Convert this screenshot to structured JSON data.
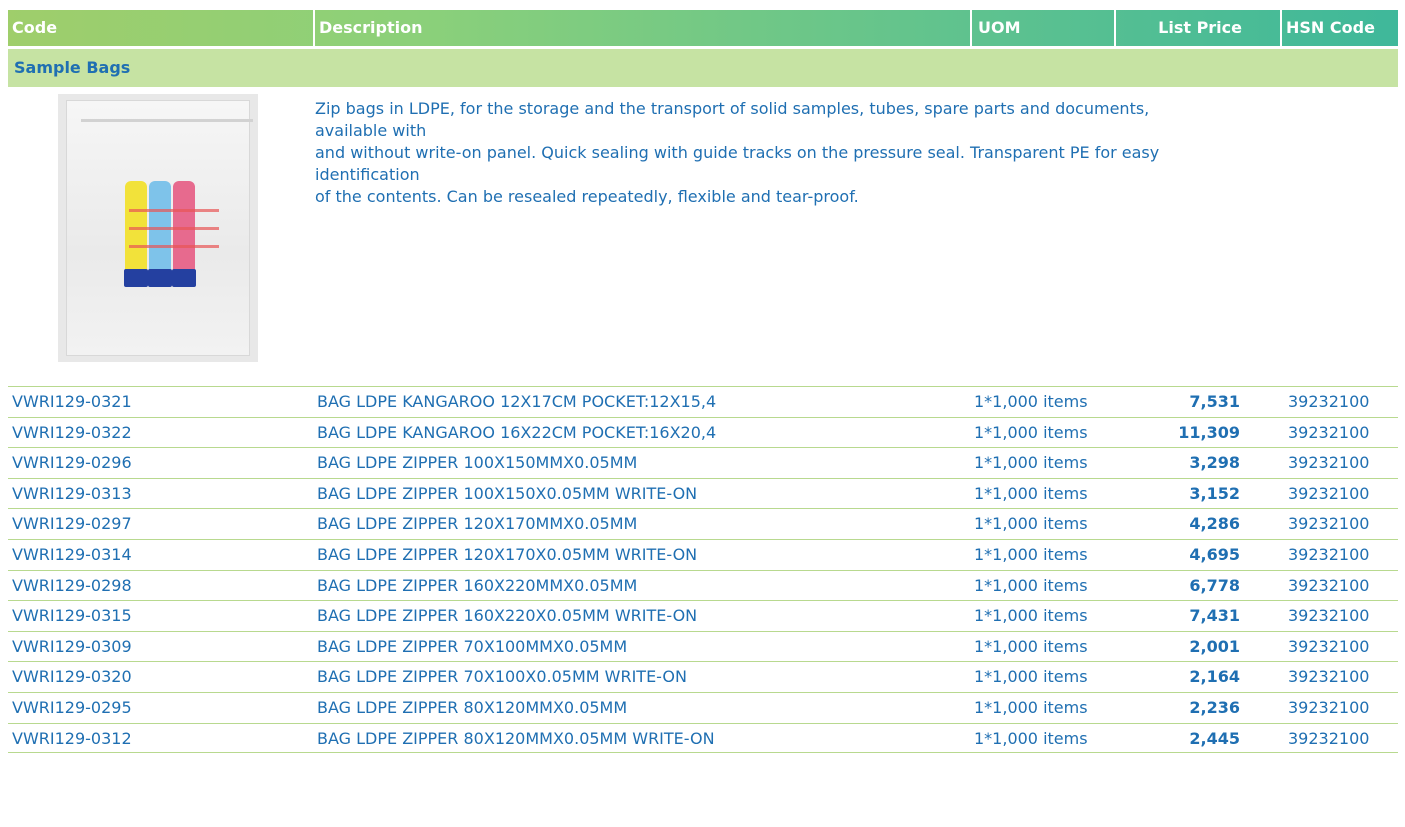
{
  "header": {
    "code": "Code",
    "description": "Description",
    "uom": "UOM",
    "list_price": "List Price",
    "hsn_code": "HSN Code"
  },
  "category": "Sample Bags",
  "product": {
    "description_lines": [
      "Zip bags in LDPE, for the storage and the transport of solid samples, tubes, spare parts and documents,",
      "available with",
      "and without write-on panel. Quick sealing with guide tracks on the pressure seal. Transparent PE for easy",
      "identification",
      "of the contents. Can be resealed repeatedly, flexible and tear-proof."
    ],
    "image_icon": "sample-bag-photo"
  },
  "rows": [
    {
      "code": "VWRI129-0321",
      "description": "BAG LDPE KANGAROO 12X17CM POCKET:12X15,4",
      "uom": "1*1,000 items",
      "price": "7,531",
      "hsn": "39232100"
    },
    {
      "code": "VWRI129-0322",
      "description": "BAG LDPE KANGAROO 16X22CM POCKET:16X20,4",
      "uom": "1*1,000 items",
      "price": "11,309",
      "hsn": "39232100"
    },
    {
      "code": "VWRI129-0296",
      "description": "BAG LDPE ZIPPER 100X150MMX0.05MM",
      "uom": "1*1,000 items",
      "price": "3,298",
      "hsn": "39232100"
    },
    {
      "code": "VWRI129-0313",
      "description": "BAG LDPE ZIPPER 100X150X0.05MM WRITE-ON",
      "uom": "1*1,000 items",
      "price": "3,152",
      "hsn": "39232100"
    },
    {
      "code": "VWRI129-0297",
      "description": "BAG LDPE ZIPPER 120X170MMX0.05MM",
      "uom": "1*1,000 items",
      "price": "4,286",
      "hsn": "39232100"
    },
    {
      "code": "VWRI129-0314",
      "description": "BAG LDPE ZIPPER 120X170X0.05MM WRITE-ON",
      "uom": "1*1,000 items",
      "price": "4,695",
      "hsn": "39232100"
    },
    {
      "code": "VWRI129-0298",
      "description": "BAG LDPE ZIPPER 160X220MMX0.05MM",
      "uom": "1*1,000 items",
      "price": "6,778",
      "hsn": "39232100"
    },
    {
      "code": "VWRI129-0315",
      "description": "BAG LDPE ZIPPER 160X220X0.05MM WRITE-ON",
      "uom": "1*1,000 items",
      "price": "7,431",
      "hsn": "39232100"
    },
    {
      "code": "VWRI129-0309",
      "description": "BAG LDPE ZIPPER 70X100MMX0.05MM",
      "uom": "1*1,000 items",
      "price": "2,001",
      "hsn": "39232100"
    },
    {
      "code": "VWRI129-0320",
      "description": "BAG LDPE ZIPPER 70X100X0.05MM WRITE-ON",
      "uom": "1*1,000 items",
      "price": "2,164",
      "hsn": "39232100"
    },
    {
      "code": "VWRI129-0295",
      "description": "BAG LDPE ZIPPER 80X120MMX0.05MM",
      "uom": "1*1,000 items",
      "price": "2,236",
      "hsn": "39232100"
    },
    {
      "code": "VWRI129-0312",
      "description": "BAG LDPE ZIPPER 80X120MMX0.05MM WRITE-ON",
      "uom": "1*1,000 items",
      "price": "2,445",
      "hsn": "39232100"
    }
  ],
  "colors": {
    "header_start": "#9fce6b",
    "header_end": "#3fb89a",
    "category_bg": "#c6e3a3",
    "text_blue": "#1f6fb2",
    "row_rule": "#b8d98f"
  }
}
